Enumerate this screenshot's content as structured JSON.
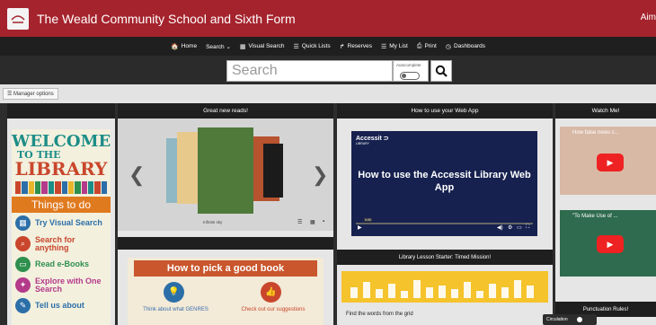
{
  "header": {
    "school_name": "The Weald Community School and Sixth Form",
    "user": "Aim"
  },
  "nav": [
    {
      "icon": "home-icon",
      "glyph": "🏠",
      "label": "Home"
    },
    {
      "icon": "",
      "glyph": "",
      "label": "Search ⌄"
    },
    {
      "icon": "grid-icon",
      "glyph": "▦",
      "label": "Visual Search"
    },
    {
      "icon": "list-icon",
      "glyph": "☰",
      "label": "Quick Lists"
    },
    {
      "icon": "share-icon",
      "glyph": "↱",
      "label": "Reserves"
    },
    {
      "icon": "list-icon",
      "glyph": "☰",
      "label": "My List"
    },
    {
      "icon": "print-icon",
      "glyph": "⎙",
      "label": "Print"
    },
    {
      "icon": "dashboard-icon",
      "glyph": "◷",
      "label": "Dashboards"
    }
  ],
  "search": {
    "placeholder": "Search",
    "autocomplete_label": "Autocomplete"
  },
  "manager": {
    "label": "☰ Manager options"
  },
  "columns": {
    "great_reads": {
      "title": "Great new reads!",
      "caption": "Infinite sky"
    },
    "webapp": {
      "title": "How to use your Web App"
    },
    "watch": {
      "title": "Watch Me!"
    }
  },
  "welcome": {
    "line1": "WELCOME",
    "line2": "TO THE",
    "line3": "LIBRARY",
    "things": "Things to do",
    "items": [
      {
        "text": "Try Visual Search",
        "color": "#2c6fa8",
        "glyph": "▦"
      },
      {
        "text": "Search for anything",
        "color": "#c9462c",
        "glyph": "⌕"
      },
      {
        "text": "Read e-Books",
        "color": "#2f8f4e",
        "glyph": "▭"
      },
      {
        "text": "Explore with One Search",
        "color": "#b43a8a",
        "glyph": "✦"
      },
      {
        "text": "Tell us about",
        "color": "#2c6fa8",
        "glyph": "✎"
      }
    ]
  },
  "howto": {
    "title": "How to pick a good book",
    "left_text": "Think about what GENRES",
    "right_text": "Check out our suggestions"
  },
  "video": {
    "logo": "Accessit ⊃",
    "sublogo": "LIBRARY",
    "title": "How to use the Accessit Library Web App",
    "time": "0:00"
  },
  "lesson": {
    "title": "Library Lesson Starter: Timed Mission!",
    "text": "Find the words from the grid"
  },
  "watch_videos": [
    {
      "title": "How false news c..."
    },
    {
      "title": "\"To Make Use of ..."
    }
  ],
  "punctuation": {
    "title": "Punctuation Rules!"
  },
  "circulation": {
    "label": "Circulation"
  },
  "colors": {
    "header_red": "#a5232d",
    "nav_dark": "#1f1f1f"
  }
}
